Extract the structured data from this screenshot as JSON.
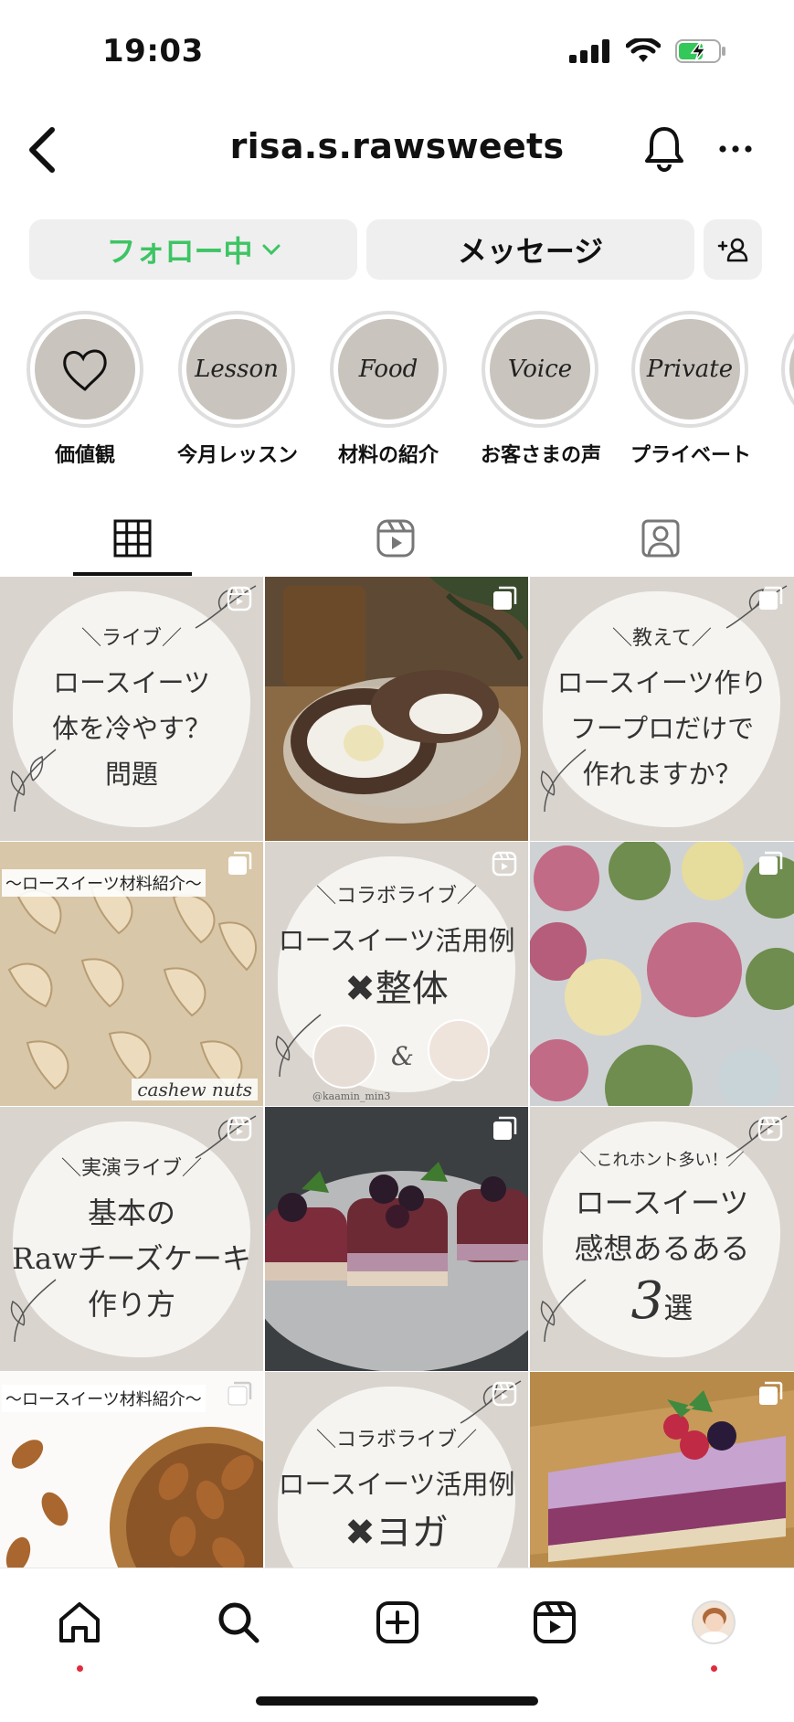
{
  "status_bar": {
    "time": "19:03"
  },
  "header": {
    "username": "risa.s.rawsweets",
    "back_icon": "chevron-left-icon",
    "bell_icon": "bell-icon",
    "more_icon": "more-horizontal-icon"
  },
  "actions": {
    "follow_label": "フォロー中",
    "message_label": "メッセージ",
    "follow_color": "#3ec464"
  },
  "highlights": [
    {
      "cover": "",
      "label": "価値観",
      "icon": "heart-icon"
    },
    {
      "cover": "Lesson",
      "label": "今月レッスン"
    },
    {
      "cover": "Food",
      "label": "材料の紹介"
    },
    {
      "cover": "Voice",
      "label": "お客さまの声"
    },
    {
      "cover": "Private",
      "label": "プライベート"
    }
  ],
  "tabs": [
    {
      "name": "grid",
      "icon": "grid-icon",
      "active": true
    },
    {
      "name": "reels",
      "icon": "reels-icon",
      "active": false
    },
    {
      "name": "tagged",
      "icon": "tagged-user-icon",
      "active": false
    }
  ],
  "posts": {
    "p1": {
      "small": "＼ライブ／",
      "l1": "ロースイーツ",
      "l2": "体を冷やす？",
      "l3": "問題"
    },
    "p3": {
      "small": "＼教えて／",
      "l1": "ロースイーツ作り",
      "l2": "フープロだけで",
      "l3": "作れますか？"
    },
    "p4": {
      "label": "〜ロースイーツ材料紹介〜",
      "sub": "cashew nuts"
    },
    "p5": {
      "small": "＼コラボライブ／",
      "l1": "ロースイーツ活用例",
      "l2": "✖︎整体",
      "amp": "&",
      "credit": "@kaamin_min3"
    },
    "p7": {
      "small": "＼実演ライブ／",
      "l1": "基本の",
      "l2": "Rawチーズケーキ",
      "l3": "作り方"
    },
    "p9": {
      "small": "＼これホント多い！／",
      "l1": "ロースイーツ",
      "l2": "感想あるある",
      "num": "3",
      "l3": "選"
    },
    "p10": {
      "label": "〜ロースイーツ材料紹介〜"
    },
    "p11": {
      "small": "＼コラボライブ／",
      "l1": "ロースイーツ活用例",
      "l2": "✖︎ヨガ"
    }
  },
  "bottom_nav": [
    {
      "name": "home",
      "icon": "home-icon"
    },
    {
      "name": "search",
      "icon": "search-icon"
    },
    {
      "name": "create",
      "icon": "plus-square-icon"
    },
    {
      "name": "reels",
      "icon": "reels-icon"
    },
    {
      "name": "profile",
      "icon": "profile-avatar-icon"
    }
  ]
}
